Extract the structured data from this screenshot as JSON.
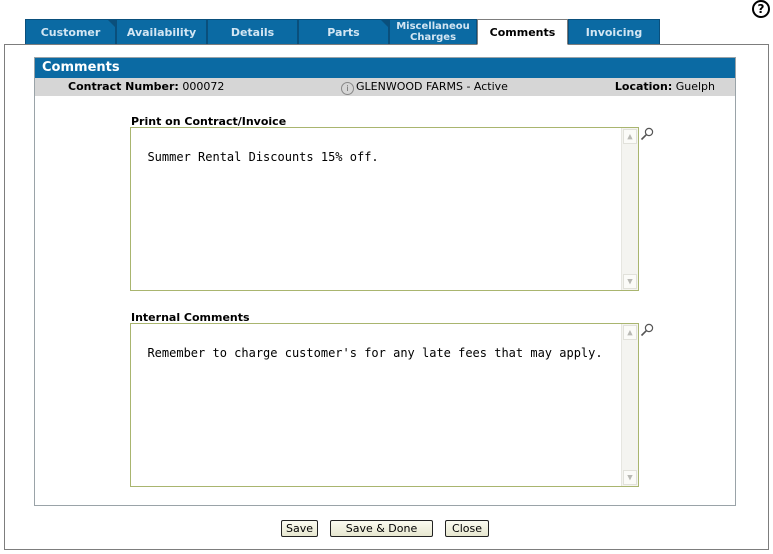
{
  "tabs": [
    {
      "label": "Customer",
      "active": false
    },
    {
      "label": "Availability",
      "active": false
    },
    {
      "label": "Details",
      "active": false
    },
    {
      "label": "Parts",
      "active": false
    },
    {
      "label": "Miscellaneou Charges",
      "active": false
    },
    {
      "label": "Comments",
      "active": true
    },
    {
      "label": "Invoicing",
      "active": false
    }
  ],
  "help_icon": {
    "glyph": "?"
  },
  "panel": {
    "title": "Comments"
  },
  "info": {
    "contract_label": "Contract Number:",
    "contract_value": "000072",
    "customer": "GLENWOOD FARMS - Active",
    "location_label": "Location:",
    "location_value": "Guelph"
  },
  "print_on_contract": {
    "label": "Print on Contract/Invoice",
    "value": "Summer Rental Discounts 15% off."
  },
  "internal_comments": {
    "label": "Internal Comments",
    "value": "Remember to charge customer's for any late fees that may apply."
  },
  "buttons": {
    "save": "Save",
    "save_done": "Save & Done",
    "close": "Close"
  },
  "colors": {
    "tab_blue": "#0b6aa3",
    "header_blue": "#0b6aa3",
    "info_gray": "#d6d6d6"
  }
}
